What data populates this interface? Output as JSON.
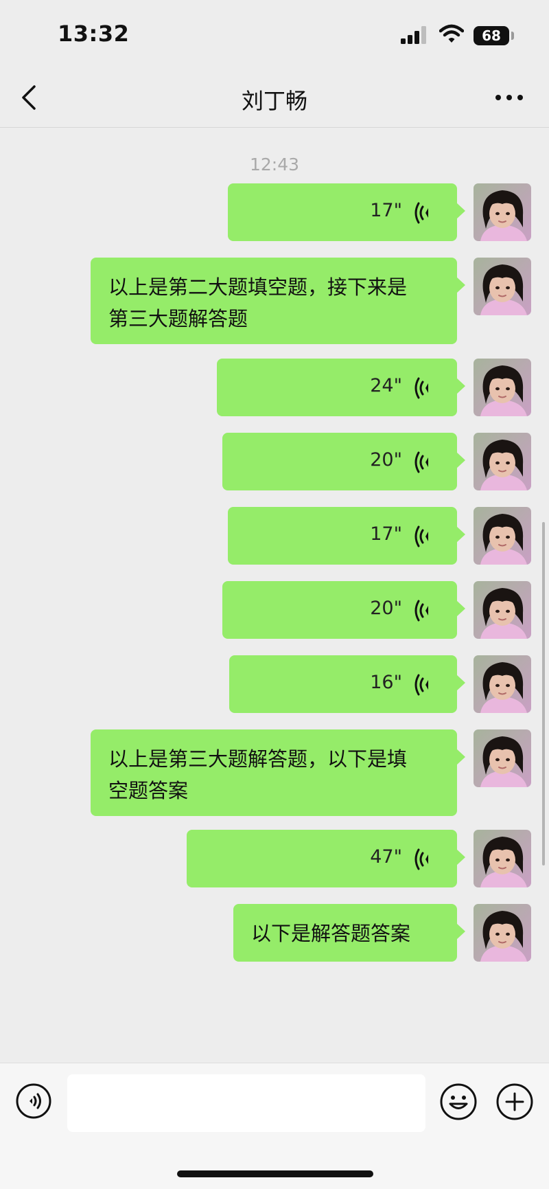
{
  "status_bar": {
    "time": "13:32",
    "battery": "68"
  },
  "nav": {
    "title": "刘丁畅"
  },
  "chat": {
    "timestamp": "12:43",
    "messages": [
      {
        "type": "voice",
        "duration": "17\""
      },
      {
        "type": "text",
        "text": "以上是第二大题填空题，接下来是第三大题解答题"
      },
      {
        "type": "voice",
        "duration": "24\""
      },
      {
        "type": "voice",
        "duration": "20\""
      },
      {
        "type": "voice",
        "duration": "17\""
      },
      {
        "type": "voice",
        "duration": "20\""
      },
      {
        "type": "voice",
        "duration": "16\""
      },
      {
        "type": "text",
        "text": "以上是第三大题解答题，以下是填空题答案"
      },
      {
        "type": "voice",
        "duration": "47\""
      },
      {
        "type": "text",
        "text": "以下是解答题答案"
      }
    ]
  },
  "input": {
    "placeholder": ""
  },
  "colors": {
    "bubble": "#95ec69",
    "background": "#ededed"
  }
}
